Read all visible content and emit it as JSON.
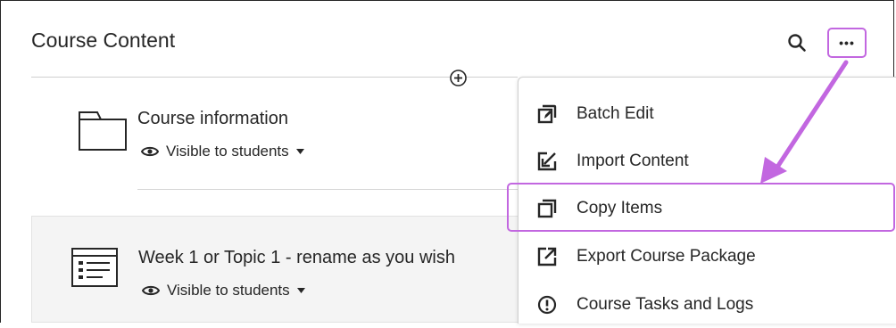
{
  "header": {
    "title": "Course Content"
  },
  "toolbar": {
    "search_icon": "search-icon",
    "more_label": "•••"
  },
  "items": [
    {
      "title": "Course information",
      "visibility": "Visible to students",
      "icon": "folder-icon"
    },
    {
      "title": "Week 1 or Topic 1 - rename as you wish",
      "visibility": "Visible to students",
      "icon": "learning-module-icon"
    }
  ],
  "menu": {
    "items": [
      {
        "label": "Batch Edit",
        "icon": "batch-edit-icon"
      },
      {
        "label": "Import Content",
        "icon": "import-icon"
      },
      {
        "label": "Copy Items",
        "icon": "copy-icon"
      },
      {
        "label": "Export Course Package",
        "icon": "export-icon"
      },
      {
        "label": "Course Tasks and Logs",
        "icon": "alert-icon"
      }
    ]
  },
  "colors": {
    "highlight": "#c267e0",
    "text": "#262626"
  }
}
